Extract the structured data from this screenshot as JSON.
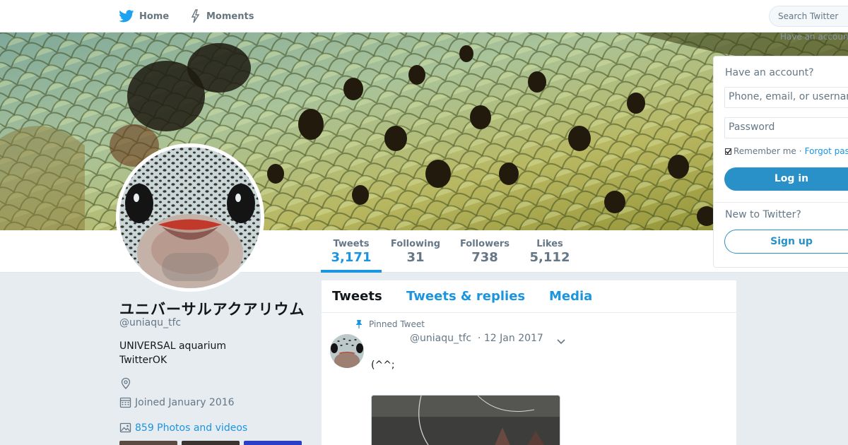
{
  "nav": {
    "home_label": "Home",
    "moments_label": "Moments",
    "search_placeholder": "Search Twitter",
    "have_account_faint": "Have an account?"
  },
  "colors": {
    "accent": "#1b95e0",
    "login_button": "#2a91c8",
    "page_bg": "#e6ecf0"
  },
  "stats": [
    {
      "label": "Tweets",
      "value": "3,171"
    },
    {
      "label": "Following",
      "value": "31"
    },
    {
      "label": "Followers",
      "value": "738"
    },
    {
      "label": "Likes",
      "value": "5,112"
    }
  ],
  "profile": {
    "name": "ユニバーサルアクアリウム",
    "handle": "@uniaqu_tfc",
    "bio_line1": "UNIVERSAL aquarium",
    "bio_line2": "TwitterOK",
    "joined": "Joined January 2016",
    "photos_link": "859 Photos and videos"
  },
  "timeline": {
    "tabs": [
      "Tweets",
      "Tweets & replies",
      "Media"
    ],
    "pinned_label": "Pinned Tweet",
    "tweet": {
      "handle": "@uniaqu_tfc",
      "date": "· 12 Jan 2017",
      "text": "(^^;"
    }
  },
  "login": {
    "title": "Have an account?",
    "username_placeholder": "Phone, email, or username",
    "password_placeholder": "Password",
    "remember_label": "Remember me",
    "separator": "·",
    "forgot_label": "Forgot password?",
    "login_button": "Log in",
    "new_title": "New to Twitter?",
    "signup_button": "Sign up"
  },
  "icons": {
    "home": "twitter-bird-icon",
    "moments": "lightning-icon",
    "location": "location-pin-icon",
    "calendar": "calendar-icon",
    "photos": "image-icon",
    "pin": "pin-icon",
    "caret": "chevron-down-icon"
  }
}
